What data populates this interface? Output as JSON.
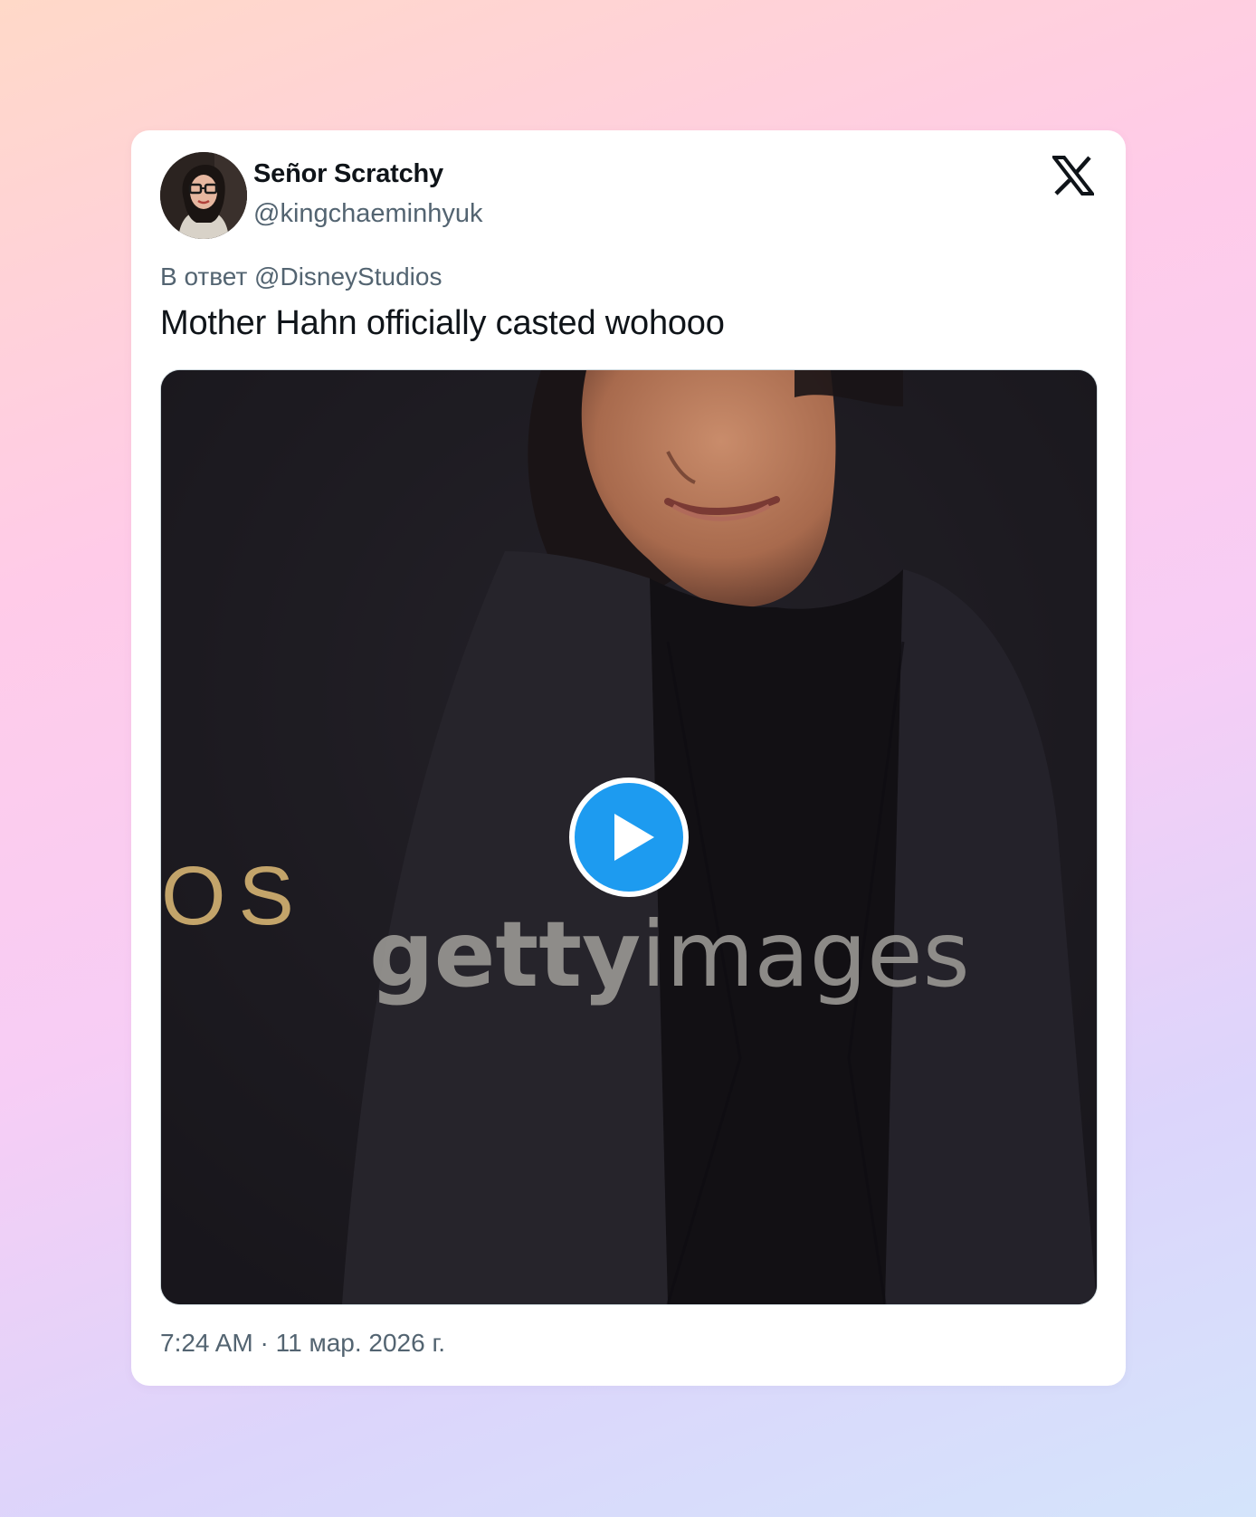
{
  "tweet": {
    "author": {
      "display_name": "Señor Scratchy",
      "handle": "@kingchaeminhyuk",
      "avatar_icon": "user-avatar"
    },
    "platform_icon": "x-logo-icon",
    "reply_to": "В ответ @DisneyStudios",
    "text": "Mother Hahn officially casted wohooo",
    "media": {
      "type": "video",
      "overlay_text_left": "OS",
      "watermark_bold": "getty",
      "watermark_light": "images",
      "play_icon": "play-icon",
      "accent_color": "#1d9bf0"
    },
    "timestamp": "7:24 AM · 11 мар. 2026 г."
  }
}
